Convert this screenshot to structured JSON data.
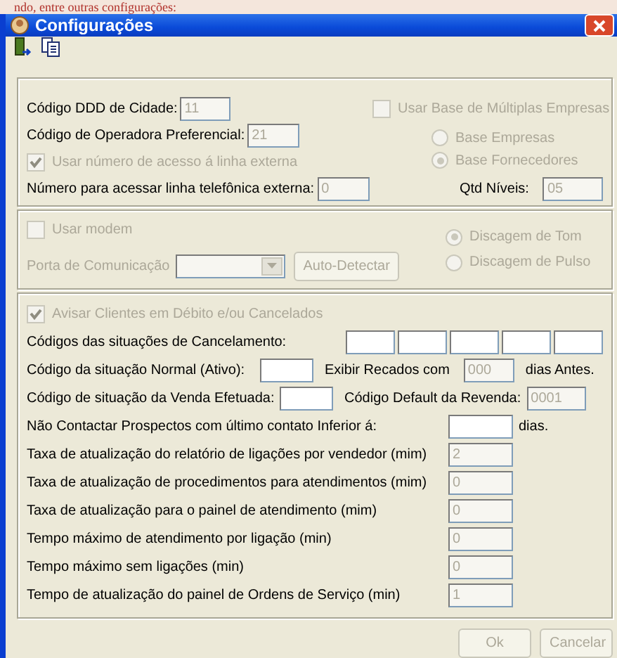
{
  "background_text": "ndo, entre outras configurações:",
  "window": {
    "title": "Configurações"
  },
  "panel_phone": {
    "ddd": {
      "label": "Código DDD de Cidade:",
      "value": "11",
      "disabled": true
    },
    "operator": {
      "label": "Código de Operadora Preferencial:",
      "value": "21",
      "disabled": true
    },
    "use_access_number": {
      "label": "Usar número de acesso á  linha externa",
      "checked": true,
      "disabled": true
    },
    "external_number": {
      "label": "Número para acessar  linha telefônica externa:",
      "value": "0",
      "disabled": true
    },
    "multi_company": {
      "label": "Usar Base de Múltiplas Empresas",
      "checked": false,
      "disabled": true
    },
    "base_options": [
      {
        "label": "Base Empresas",
        "selected": false
      },
      {
        "label": "Base Fornecedores",
        "selected": true
      }
    ],
    "levels": {
      "label": "Qtd Níveis:",
      "value": "05",
      "disabled": true
    }
  },
  "panel_modem": {
    "use_modem": {
      "label": "Usar  modem",
      "checked": false,
      "disabled": true
    },
    "port": {
      "label": "Porta de Comunicação",
      "disabled": true
    },
    "detect_button": {
      "label": "Auto-Detectar",
      "disabled": true
    },
    "dialing": [
      {
        "label": "Discagem de Tom",
        "selected": true
      },
      {
        "label": "Discagem de Pulso",
        "selected": false
      }
    ]
  },
  "panel_clients": {
    "warn": {
      "label": "Avisar Clientes em Débito e/ou Cancelados",
      "checked": true,
      "disabled": true
    },
    "cancel_codes": {
      "label": "Códigos das situações de Cancelamento:",
      "fields": [
        {
          "disabled": false
        },
        {
          "disabled": false
        },
        {
          "disabled": false
        },
        {
          "disabled": false
        },
        {
          "disabled": false
        }
      ]
    },
    "normal": {
      "label": "Código da situação Normal (Ativo):",
      "messages_label": "Exibir Recados com",
      "messages_value": "000",
      "suffix": "dias Antes."
    },
    "sale": {
      "label": "Código de situação da Venda Efetuada:",
      "default_label": "Código Default da Revenda:",
      "default_value": "0001"
    },
    "no_contact": {
      "label": "Não Contactar Prospectos  com último contato Inferior á:",
      "suffix": "dias."
    },
    "rates": [
      {
        "label": "Taxa de atualização do relatório de ligações por vendedor (mim)",
        "value": "2"
      },
      {
        "label": "Taxa de atualização de procedimentos para atendimentos (mim)",
        "value": "0"
      },
      {
        "label": "Taxa de atualização para o painel de atendimento (mim)",
        "value": "0"
      },
      {
        "label": "Tempo máximo de atendimento por ligação (min)",
        "value": "0"
      },
      {
        "label": "Tempo máximo sem ligações (min)",
        "value": "0"
      },
      {
        "label": "Tempo de atualização do painel de Ordens de Serviço (min)",
        "value": "1"
      }
    ]
  },
  "buttons": [
    {
      "label": "Ok",
      "disabled": true
    },
    {
      "label": "Cancelar",
      "disabled": true
    }
  ]
}
